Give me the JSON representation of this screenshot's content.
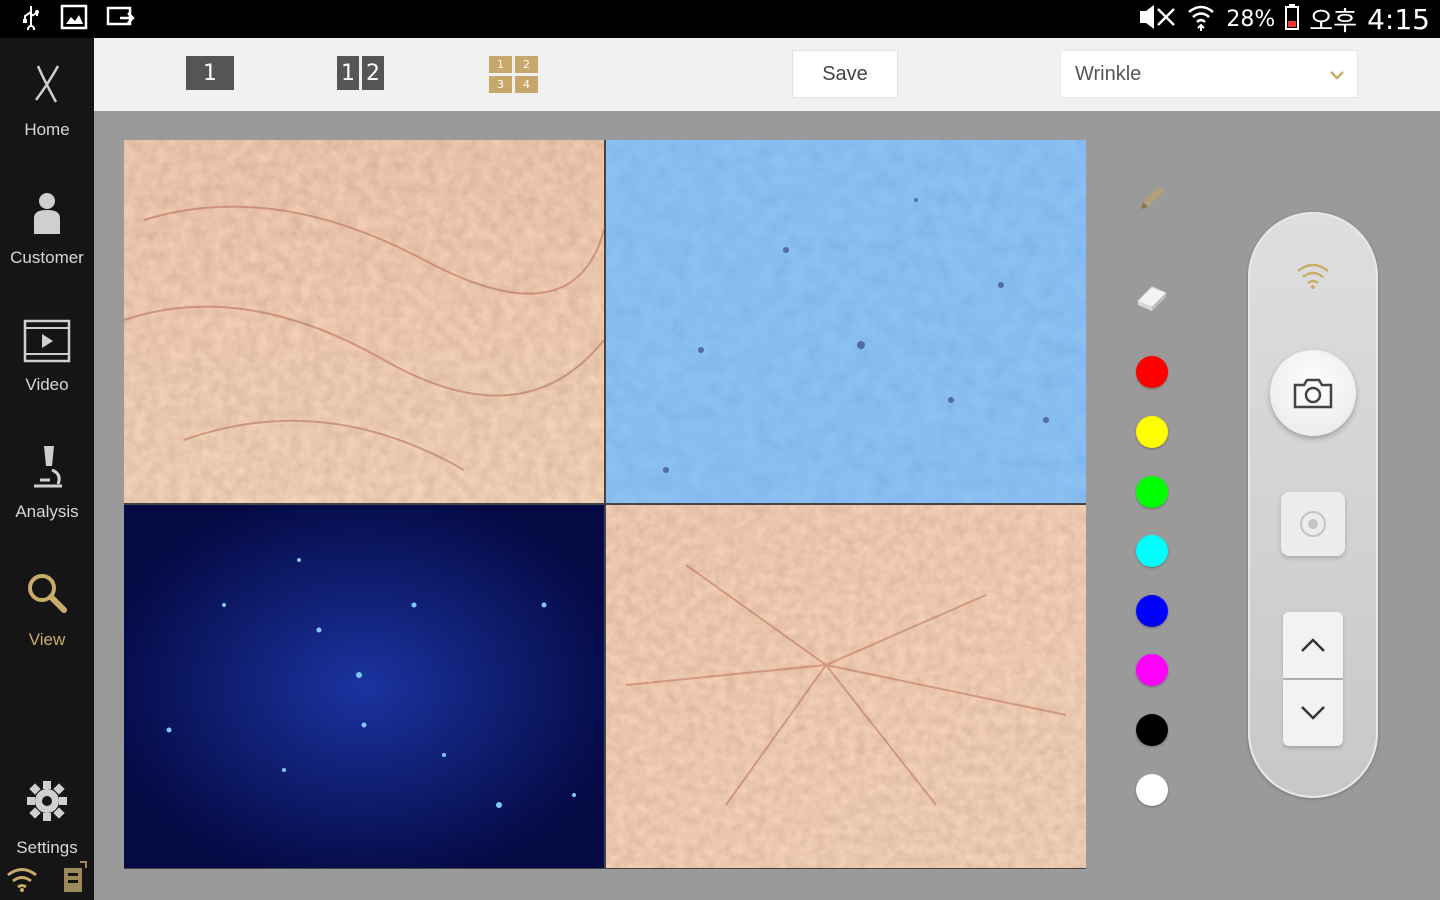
{
  "statusbar": {
    "battery": "28%",
    "ampm": "오후",
    "time": "4:15"
  },
  "sidebar": {
    "items": [
      {
        "label": "Home",
        "icon": "home-icon"
      },
      {
        "label": "Customer",
        "icon": "person-icon"
      },
      {
        "label": "Video",
        "icon": "video-icon"
      },
      {
        "label": "Analysis",
        "icon": "microscope-icon"
      },
      {
        "label": "View",
        "icon": "magnifier-icon"
      },
      {
        "label": "Settings",
        "icon": "gear-icon"
      }
    ],
    "active": "View"
  },
  "toolbar": {
    "layout_single": "1",
    "layout_dual": [
      "1",
      "2"
    ],
    "layout_quad": [
      "1",
      "2",
      "3",
      "4"
    ],
    "save_label": "Save",
    "mode_select": "Wrinkle"
  },
  "tools": {
    "pencil": "pencil-icon",
    "eraser": "eraser-icon",
    "colors": [
      "#ff0000",
      "#ffff00",
      "#00ff00",
      "#00ffff",
      "#0000ff",
      "#ff00ff",
      "#000000",
      "#ffffff"
    ]
  },
  "colors": {
    "accent": "#c9ab6a",
    "sidebar_bg": "#151515",
    "content_bg": "#9a9a9a",
    "toolbar_bg": "#f1f1f1"
  },
  "images": [
    {
      "name": "skin-normal-light"
    },
    {
      "name": "skin-polarized-blue"
    },
    {
      "name": "skin-uv-dark"
    },
    {
      "name": "skin-normal-light-2"
    }
  ]
}
